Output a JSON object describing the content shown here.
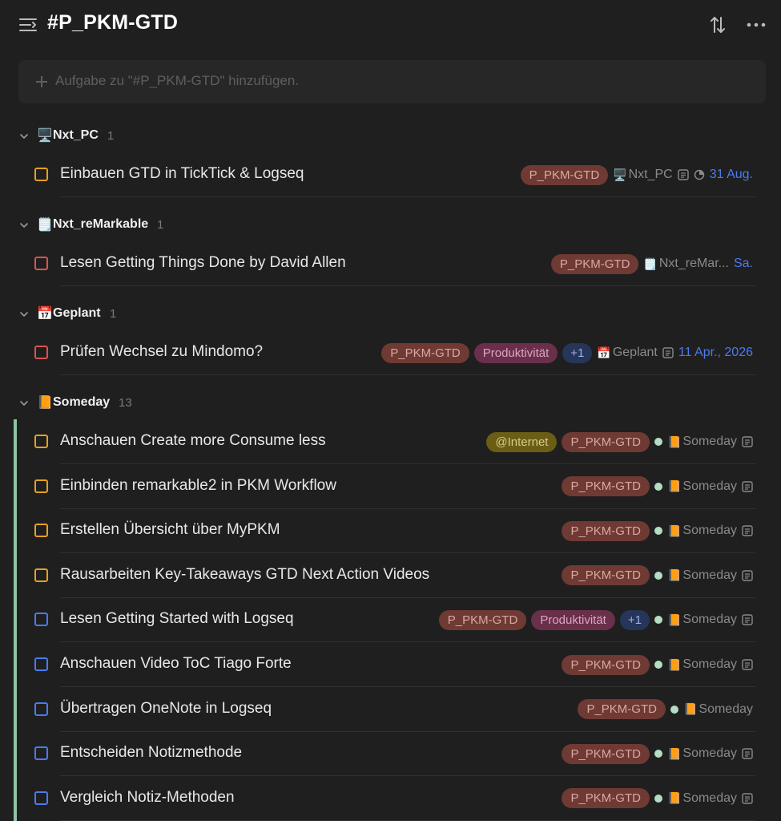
{
  "header": {
    "title": "#P_PKM-GTD"
  },
  "add_task": {
    "placeholder": "Aufgabe zu \"#P_PKM-GTD\" hinzufügen."
  },
  "colors": {
    "background": "#1f1f1f",
    "priority_high": "#d9534f",
    "priority_medium": "#e6a023",
    "priority_low": "#4a7bf0",
    "date": "#4a7bf0",
    "someday_accent": "#8fc3a1"
  },
  "sections": [
    {
      "emoji": "🖥️",
      "name": "Nxt_PC",
      "count": "1",
      "tasks": [
        {
          "title": "Einbauen GTD in TickTick & Logseq",
          "priority": "orange",
          "tags": [
            "P_PKM-GTD"
          ],
          "list_emoji": "🖥️",
          "list": "Nxt_PC",
          "date": "31 Aug."
        }
      ]
    },
    {
      "emoji": "🗒️",
      "name": "Nxt_reMarkable",
      "count": "1",
      "tasks": [
        {
          "title": "Lesen Getting Things Done by David Allen",
          "priority": "red",
          "tags": [
            "P_PKM-GTD"
          ],
          "list_emoji": "🗒️",
          "list": "Nxt_reMar...",
          "date": "Sa."
        }
      ]
    },
    {
      "emoji": "📅",
      "name": "Geplant",
      "count": "1",
      "tasks": [
        {
          "title": "Prüfen Wechsel zu Mindomo?",
          "priority": "red",
          "tags": [
            "P_PKM-GTD",
            "Produktivität"
          ],
          "more": "+1",
          "list_emoji": "📅",
          "list": "Geplant",
          "date": "11 Apr., 2026"
        }
      ]
    },
    {
      "emoji": "📙",
      "name": "Someday",
      "count": "13",
      "tasks": [
        {
          "title": "Anschauen Create more Consume less",
          "priority": "orange",
          "tags": [
            "@Internet",
            "P_PKM-GTD"
          ],
          "list_emoji": "📙",
          "list": "Someday"
        },
        {
          "title": "Einbinden remarkable2 in PKM Workflow",
          "priority": "orange",
          "tags": [
            "P_PKM-GTD"
          ],
          "list_emoji": "📙",
          "list": "Someday"
        },
        {
          "title": "Erstellen Übersicht über MyPKM",
          "priority": "orange",
          "tags": [
            "P_PKM-GTD"
          ],
          "list_emoji": "📙",
          "list": "Someday"
        },
        {
          "title": "Rausarbeiten Key-Takeaways GTD Next Action Videos",
          "priority": "orange",
          "tags": [
            "P_PKM-GTD"
          ],
          "list_emoji": "📙",
          "list": "Someday"
        },
        {
          "title": "Lesen Getting Started with Logseq",
          "priority": "blue",
          "tags": [
            "P_PKM-GTD",
            "Produktivität"
          ],
          "more": "+1",
          "list_emoji": "📙",
          "list": "Someday"
        },
        {
          "title": "Anschauen Video ToC Tiago Forte",
          "priority": "blue",
          "tags": [
            "P_PKM-GTD"
          ],
          "list_emoji": "📙",
          "list": "Someday"
        },
        {
          "title": "Übertragen OneNote in Logseq",
          "priority": "blue",
          "tags": [
            "P_PKM-GTD"
          ],
          "list_emoji": "📙",
          "list": "Someday"
        },
        {
          "title": "Entscheiden Notizmethode",
          "priority": "blue",
          "tags": [
            "P_PKM-GTD"
          ],
          "list_emoji": "📙",
          "list": "Someday"
        },
        {
          "title": "Vergleich Notiz-Methoden",
          "priority": "blue",
          "tags": [
            "P_PKM-GTD"
          ],
          "list_emoji": "📙",
          "list": "Someday"
        }
      ]
    }
  ]
}
